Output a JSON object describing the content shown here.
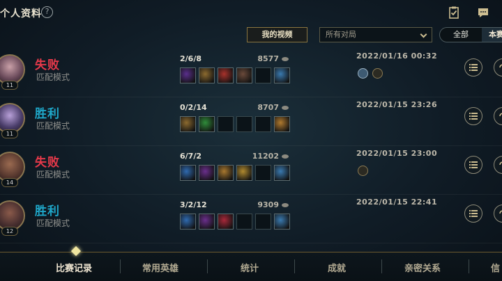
{
  "header": {
    "title": "个人资料",
    "help_icon": "?",
    "icons": [
      "clipboard-check-icon",
      "chat-bubble-icon"
    ]
  },
  "toolbar": {
    "video_label": "我的视频",
    "queue_select_value": "所有对局",
    "toggle_all": "全部",
    "toggle_mode": "本赛"
  },
  "matches": [
    {
      "result": "失败",
      "outcome": "loss",
      "mode": "匹配模式",
      "level": "11",
      "kda": "2/6/8",
      "gold": "8577",
      "date": "2022/01/16 00:32",
      "badges": [
        "blue",
        "bronze"
      ]
    },
    {
      "result": "胜利",
      "outcome": "win",
      "mode": "匹配模式",
      "level": "11",
      "kda": "0/2/14",
      "gold": "8707",
      "date": "2022/01/15 23:26",
      "badges": []
    },
    {
      "result": "失败",
      "outcome": "loss",
      "mode": "匹配模式",
      "level": "14",
      "kda": "6/7/2",
      "gold": "11202",
      "date": "2022/01/15 23:00",
      "badges": [
        "bronze"
      ]
    },
    {
      "result": "胜利",
      "outcome": "win",
      "mode": "匹配模式",
      "level": "12",
      "kda": "3/2/12",
      "gold": "9309",
      "date": "2022/01/15 22:41",
      "badges": []
    }
  ],
  "nav": {
    "tabs": [
      "比赛记录",
      "常用英雄",
      "统计",
      "成就",
      "亲密关系",
      "信"
    ],
    "active_index": 0
  },
  "colors": {
    "loss": "#e5394a",
    "win": "#1fa7c9",
    "gold_accent": "#cdbe91"
  }
}
